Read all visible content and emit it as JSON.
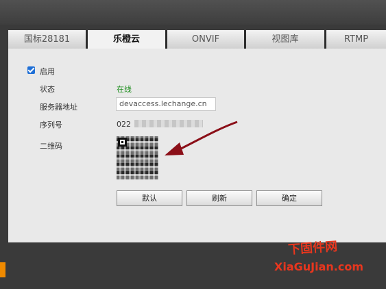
{
  "tabs": [
    {
      "label": "国标28181",
      "active": false
    },
    {
      "label": "乐橙云",
      "active": true
    },
    {
      "label": "ONVIF",
      "active": false
    },
    {
      "label": "视图库",
      "active": false
    },
    {
      "label": "RTMP",
      "active": false
    }
  ],
  "form": {
    "enable_label": "启用",
    "enabled": true,
    "status_label": "状态",
    "status_value": "在线",
    "server_label": "服务器地址",
    "server_value": "devaccess.lechange.cn",
    "serial_label": "序列号",
    "serial_value": "022",
    "qr_label": "二维码"
  },
  "buttons": {
    "default": "默认",
    "refresh": "刷新",
    "confirm": "确定"
  },
  "watermark": {
    "cn": "下固件网",
    "en": "XiaGuJian.com"
  },
  "colors": {
    "status_online": "#1b8d1b",
    "checkbox": "#1f6fd6",
    "arrow": "#8b0f18",
    "watermark": "#e8361e"
  }
}
